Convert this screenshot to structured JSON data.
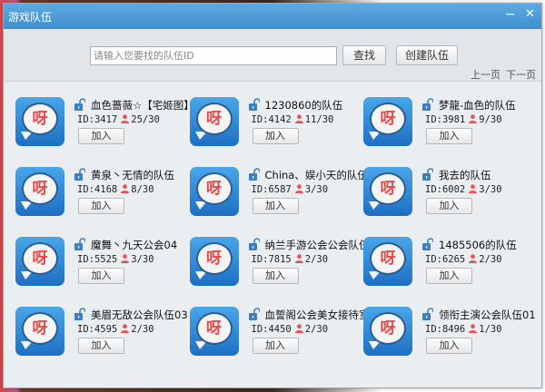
{
  "window": {
    "title": "游戏队伍",
    "minimize": "−",
    "close": "✕"
  },
  "toolbar": {
    "search_placeholder": "请输入您要找的队伍ID",
    "search_value": "",
    "search_label": "查找",
    "create_label": "创建队伍",
    "prev_label": "上一页",
    "next_label": "下一页"
  },
  "icon_text": "呀",
  "join_label": "加入",
  "teams": [
    {
      "name": "血色蔷薇☆【宅姬图】",
      "id": "ID:3417",
      "members": "25/30"
    },
    {
      "name": "1230860的队伍",
      "id": "ID:4142",
      "members": "11/30"
    },
    {
      "name": "梦龍-血色的队伍",
      "id": "ID:3981",
      "members": "9/30"
    },
    {
      "name": "黄泉丶无情的队伍",
      "id": "ID:4168",
      "members": "8/30"
    },
    {
      "name": "China、娱小天的队伍",
      "id": "ID:6587",
      "members": "3/30"
    },
    {
      "name": "我去的队伍",
      "id": "ID:6002",
      "members": "3/30"
    },
    {
      "name": "魔舞丶九天公会04",
      "id": "ID:5525",
      "members": "3/30"
    },
    {
      "name": "纳兰手游公会公会队伍",
      "id": "ID:7815",
      "members": "2/30"
    },
    {
      "name": "1485506的队伍",
      "id": "ID:6265",
      "members": "2/30"
    },
    {
      "name": "美眉无敌公会队伍03",
      "id": "ID:4595",
      "members": "2/30"
    },
    {
      "name": "血誓阁公会美女接待室",
      "id": "ID:4450",
      "members": "2/30"
    },
    {
      "name": "领衔主演公会队伍01",
      "id": "ID:8496",
      "members": "1/30"
    }
  ]
}
